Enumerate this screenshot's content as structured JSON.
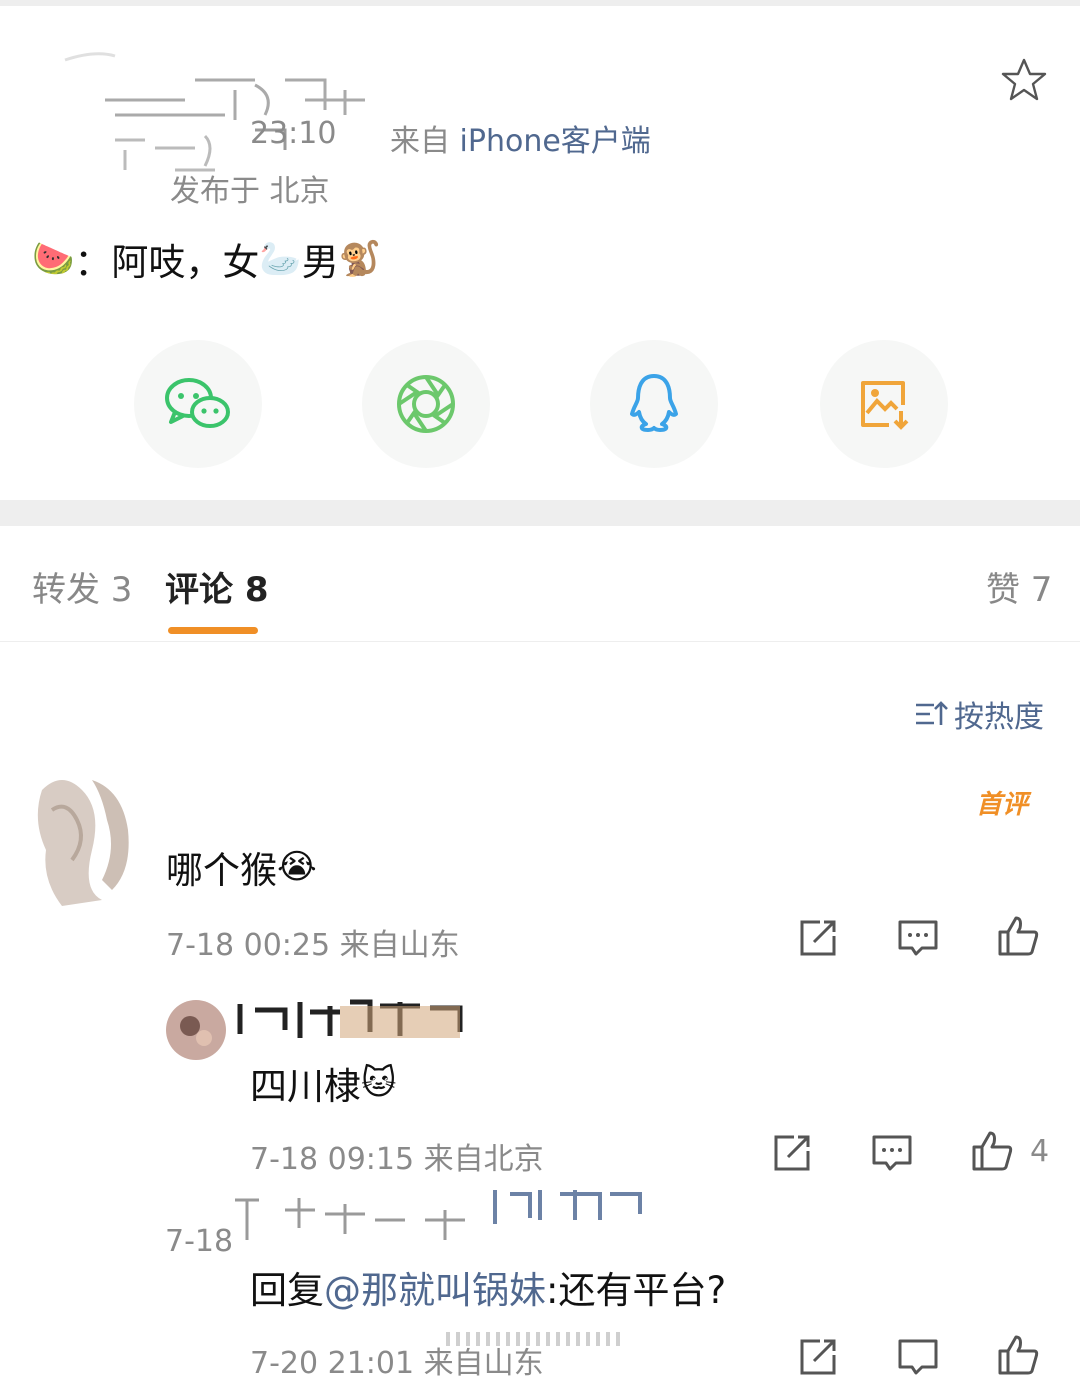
{
  "post": {
    "time": "23:10",
    "source_prefix": "来自",
    "source_client": "iPhone客户端",
    "location": "发布于 北京",
    "content_emoji_1": "🍉",
    "content_text_1": "：阿吱，女",
    "content_emoji_2": "🦢",
    "content_text_2": "男",
    "content_emoji_3": "🐒"
  },
  "share_buttons": [
    "wechat-icon",
    "moments-icon",
    "qq-icon",
    "save-image-icon"
  ],
  "tabs": {
    "repost": "转发 3",
    "comment": "评论 8",
    "like": "赞 7"
  },
  "sort": {
    "label": "按热度"
  },
  "comments": [
    {
      "badge": "首评",
      "text": "哪个猴",
      "emoji": "😭",
      "meta": "7-18 00:25  来自山东"
    }
  ],
  "replies": [
    {
      "text": "四川棣",
      "emoji": "🐱",
      "meta": "7-18 09:15  来自北京",
      "likes": "4"
    },
    {
      "date_fragment": "7-18",
      "reply_prefix": "回复",
      "mention": "@那就叫锅妹",
      "reply_text": ":还有平台?",
      "meta": "7-20 21:01  来自山东"
    }
  ],
  "colors": {
    "accent_orange": "#f08f26",
    "link_blue": "#50688f",
    "meta_gray": "#8a8a8a",
    "wechat_green": "#3bc46b",
    "moments_green": "#6cc86c",
    "qq_blue": "#3ba3e8",
    "save_orange": "#f0a53a"
  }
}
